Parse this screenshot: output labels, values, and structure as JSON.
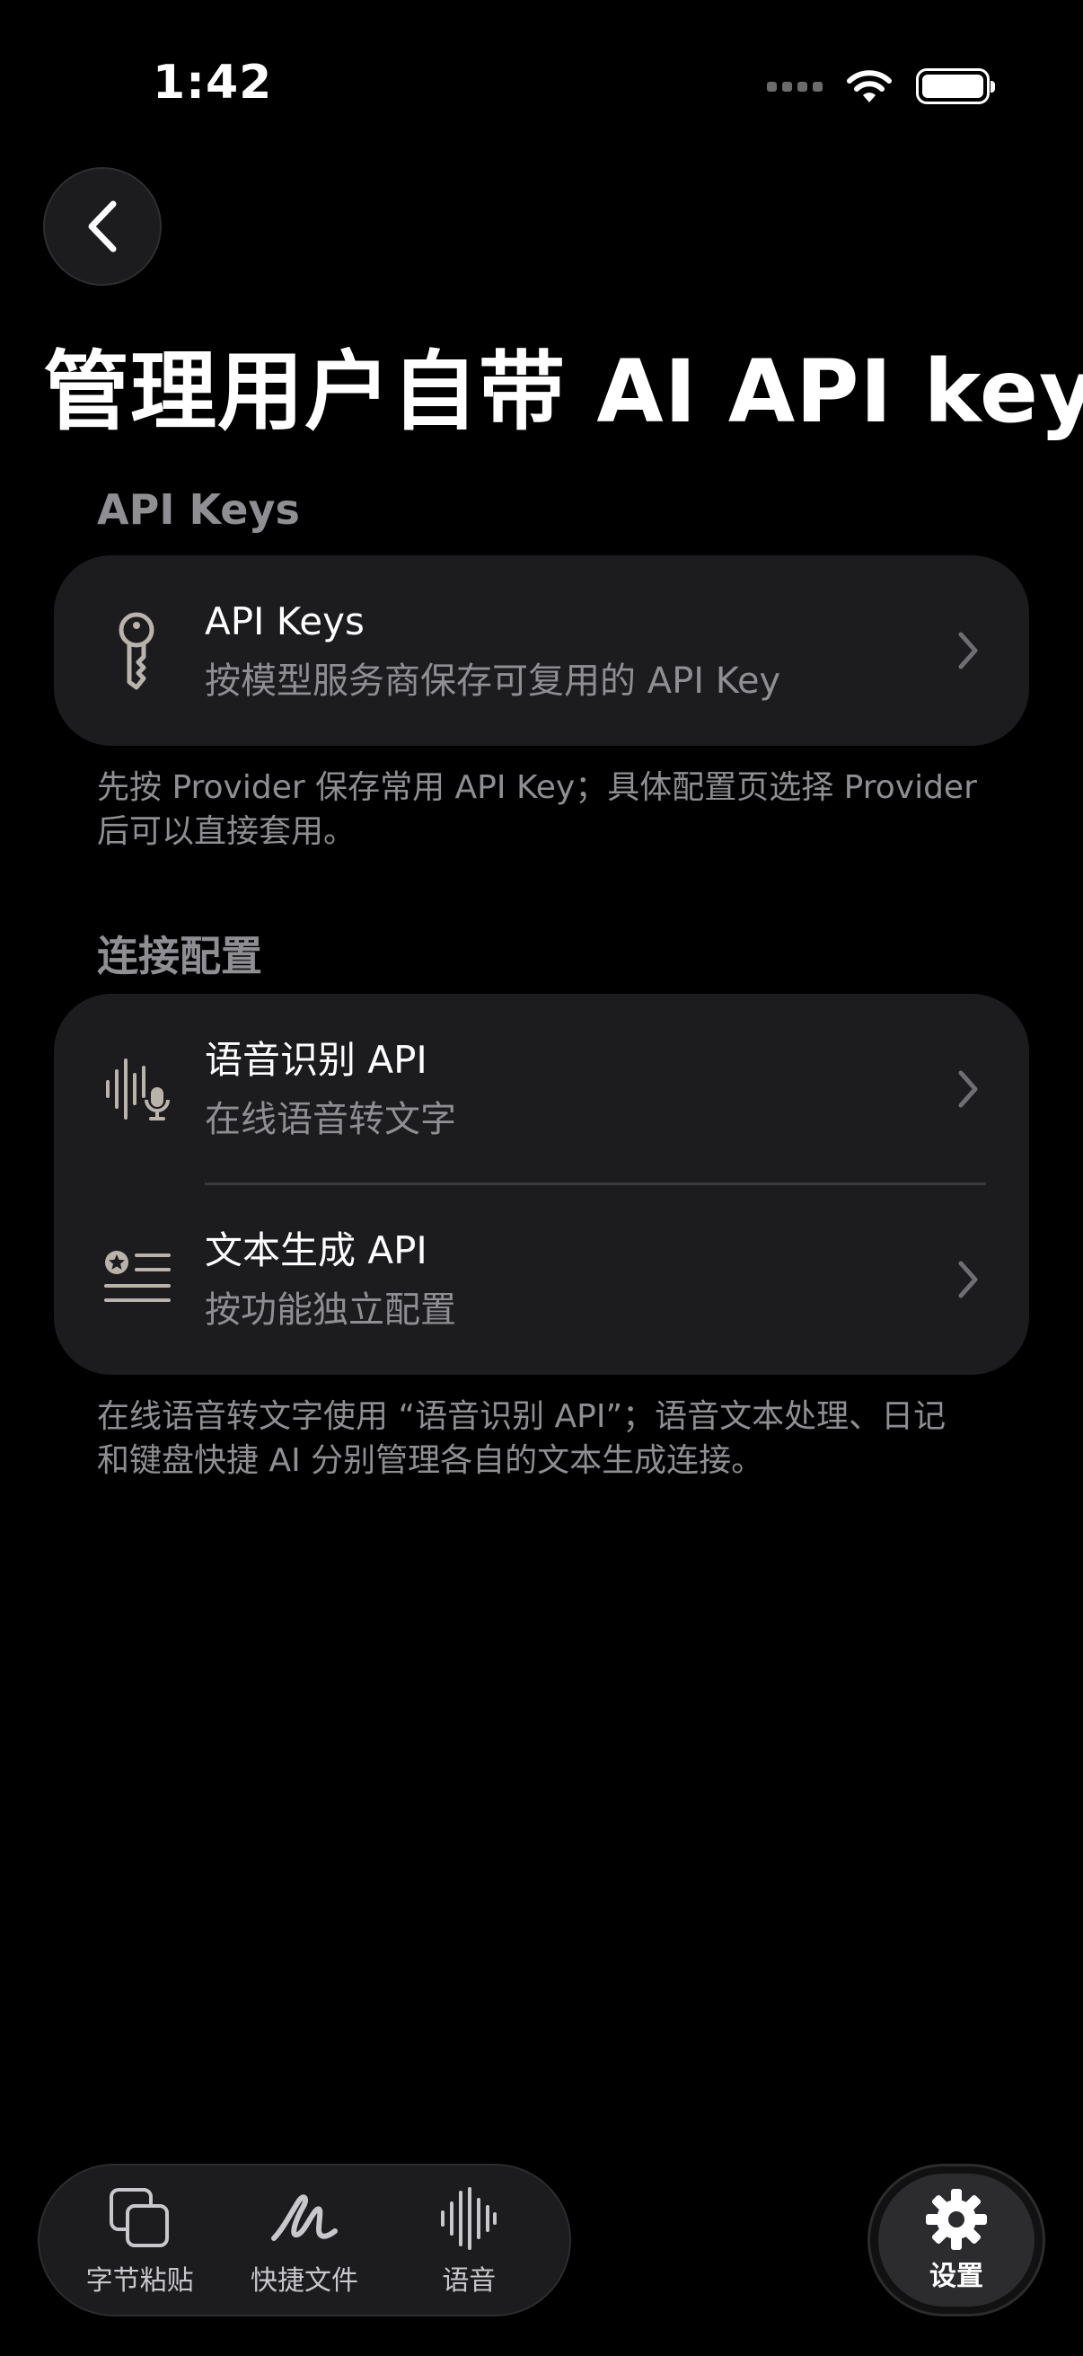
{
  "status_bar": {
    "time": "1:42"
  },
  "page": {
    "title": "管理用户自带 AI API key"
  },
  "sections": [
    {
      "header": "API Keys",
      "rows": [
        {
          "title": "API Keys",
          "subtitle": "按模型服务商保存可复用的 API Key",
          "icon": "key-icon"
        }
      ],
      "footnote": "先按 Provider 保存常用 API Key；具体配置页选择 Provider 后可以直接套用。"
    },
    {
      "header": "连接配置",
      "rows": [
        {
          "title": "语音识别 API",
          "subtitle": "在线语音转文字",
          "icon": "waveform-mic-icon"
        },
        {
          "title": "文本生成 API",
          "subtitle": "按功能独立配置",
          "icon": "text-badge-star-icon"
        }
      ],
      "footnote": "在线语音转文字使用 “语音识别 API”；语音文本处理、日记和键盘快捷 AI 分别管理各自的文本生成连接。"
    }
  ],
  "tab_bar": {
    "tabs": [
      {
        "label": "字节粘贴",
        "icon": "copy-icon"
      },
      {
        "label": "快捷文件",
        "icon": "scribble-icon"
      },
      {
        "label": "语音",
        "icon": "waveform-icon"
      }
    ],
    "settings": {
      "label": "设置",
      "icon": "gear-icon"
    }
  },
  "colors": {
    "background": "#000000",
    "card": "#1c1c1e",
    "secondary_text": "#8e8e93",
    "icon": "#b9b3aa"
  }
}
